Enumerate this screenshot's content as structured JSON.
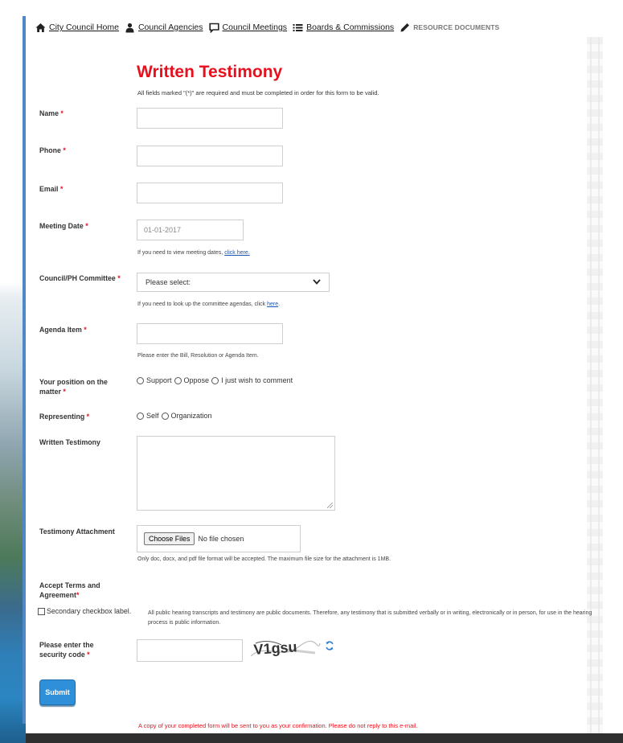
{
  "nav": {
    "items": [
      {
        "label": "City Council Home",
        "icon": "home-icon"
      },
      {
        "label": "Council Agencies",
        "icon": "person-icon"
      },
      {
        "label": "Council Meetings",
        "icon": "speech-bubble-icon"
      },
      {
        "label": "Boards & Commissions",
        "icon": "list-icon"
      },
      {
        "label": "RESOURCE DOCUMENTS",
        "icon": "pencil-icon"
      }
    ]
  },
  "form": {
    "title": "Written Testimony",
    "subtitle": "All fields marked \"(*)\" are required and must be completed in order for this form to be valid.",
    "required_mark": "*",
    "name": {
      "label": "Name",
      "value": ""
    },
    "phone": {
      "label": "Phone",
      "value": ""
    },
    "email": {
      "label": "Email",
      "value": ""
    },
    "meeting_date": {
      "label": "Meeting Date",
      "value": "01-01-2017",
      "help_prefix": "If you need to view meeting dates,",
      "help_link": "click here."
    },
    "committee": {
      "label": "Council/PH Committee",
      "selected": "Please select:",
      "help_prefix": "If you need to look up the committee agendas, click",
      "help_link": "here",
      "help_suffix": "."
    },
    "agenda_item": {
      "label": "Agenda Item",
      "value": "",
      "help": "Please enter the Bill, Resolution or Agenda Item."
    },
    "position": {
      "label_line1": "Your position on the",
      "label_line2": "matter",
      "options": [
        "Support",
        "Oppose",
        "I just wish to comment"
      ]
    },
    "representing": {
      "label": "Representing",
      "options": [
        "Self",
        "Organization"
      ]
    },
    "written_testimony": {
      "label": "Written Testimony"
    },
    "attachment": {
      "label": "Testimony Attachment",
      "button": "Choose Files",
      "status": "No file chosen",
      "help": "Only doc, docx, and pdf file format will be accepted. The maximum file size for the attachment is 1MB."
    },
    "terms": {
      "label_line1": "Accept Terms and",
      "label_line2": "Agreement",
      "checkbox_label": "Secondary checkbox label.",
      "text": "All public hearing transcripts and testimony are public documents. Therefore, any testimony that is submitted verbally or in writing, electronically or in person, for use in the hearing process is public information."
    },
    "security": {
      "label_line1": "Please enter the",
      "label_line2": "security code",
      "captcha_text": "V1gsu"
    },
    "submit": "Submit",
    "footer_note": "A copy of your completed form will be sent to you as your confirmation. Please do not reply to this e-mail."
  },
  "colors": {
    "accent_red": "#e8101d",
    "submit_blue": "#2f8fd8",
    "link_blue": "#1a57b5"
  }
}
